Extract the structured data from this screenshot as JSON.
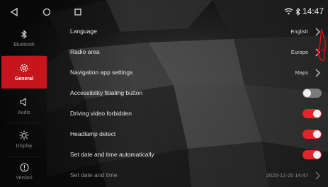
{
  "status": {
    "time": "14:47"
  },
  "sidebar": {
    "items": [
      {
        "label": "Bluetooth",
        "icon": "bluetooth-icon",
        "active": false
      },
      {
        "label": "General",
        "icon": "gear-icon",
        "active": true
      },
      {
        "label": "Audio",
        "icon": "speaker-icon",
        "active": false
      },
      {
        "label": "Display",
        "icon": "brightness-icon",
        "active": false
      },
      {
        "label": "Version",
        "icon": "info-icon",
        "active": false
      }
    ]
  },
  "settings": {
    "language": {
      "label": "Language",
      "value": "English"
    },
    "radio_area": {
      "label": "Radio area",
      "value": "Europe"
    },
    "navigation_app": {
      "label": "Navigation app settings",
      "value": "Maps"
    },
    "accessibility": {
      "label": "Accessibility floating button",
      "enabled": false
    },
    "driving_video": {
      "label": "Driving video forbidden",
      "enabled": true
    },
    "headlamp": {
      "label": "Headlamp detect",
      "enabled": true
    },
    "auto_datetime": {
      "label": "Set date and time automatically",
      "enabled": true
    },
    "set_datetime": {
      "label": "Set date and time",
      "value": "2020-12-25 14:47"
    }
  },
  "colors": {
    "accent": "#c4161c",
    "toggle_on": "#e2252b",
    "toggle_off": "#7b7b7b"
  }
}
